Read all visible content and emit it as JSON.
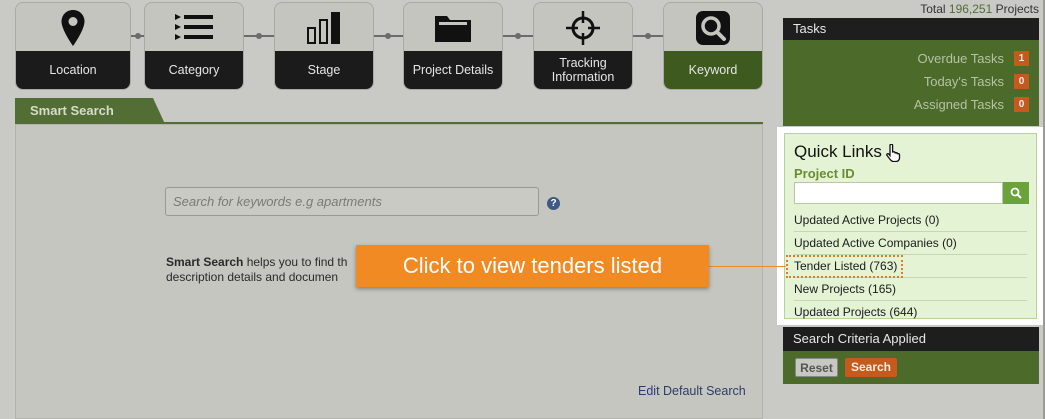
{
  "steps": [
    {
      "label": "Location",
      "icon": "map-pin-icon"
    },
    {
      "label": "Category",
      "icon": "list-icon"
    },
    {
      "label": "Stage",
      "icon": "bar-chart-icon"
    },
    {
      "label": "Project Details",
      "icon": "folder-icon"
    },
    {
      "label": "Tracking Information",
      "icon": "crosshair-icon"
    },
    {
      "label": "Keyword",
      "icon": "search-icon"
    }
  ],
  "total": {
    "prefix": "Total",
    "count": "196,251",
    "suffix": "Projects"
  },
  "smart_search": {
    "tab": "Smart Search",
    "placeholder": "Search for keywords e.g apartments",
    "help_glyph": "?",
    "desc_bold": "Smart Search",
    "desc_line1": " helps you to find th",
    "desc_line2": "description details and documen",
    "edit_default": "Edit Default Search"
  },
  "tasks": {
    "header": "Tasks",
    "items": [
      {
        "label": "Overdue Tasks",
        "count": "1"
      },
      {
        "label": "Today's Tasks",
        "count": "0"
      },
      {
        "label": "Assigned Tasks",
        "count": "0"
      }
    ]
  },
  "quick_links": {
    "title": "Quick Links",
    "project_id_label": "Project ID",
    "links": [
      "Updated Active Projects (0)",
      "Updated Active Companies (0)",
      "Tender Listed (763)",
      "New Projects (165)",
      "Updated Projects (644)"
    ]
  },
  "callout": "Click to view tenders listed",
  "criteria": {
    "header": "Search Criteria Applied",
    "reset": "Reset",
    "search": "Search"
  },
  "colors": {
    "accent_green": "#4c6a2a",
    "badge_orange": "#c65a1c",
    "callout_orange": "#f28a23"
  }
}
